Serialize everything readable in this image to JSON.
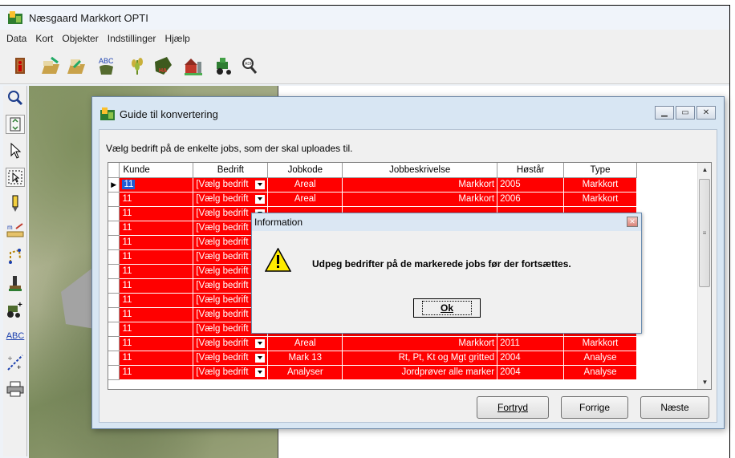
{
  "app": {
    "title": "Næsgaard Markkort OPTI"
  },
  "menu": [
    "Data",
    "Kort",
    "Objekter",
    "Indstillinger",
    "Hjælp"
  ],
  "toolbar": {
    "icons": [
      "exit-icon",
      "import-icon",
      "export-icon",
      "abc-label-icon",
      "crop-icon",
      "field-ha-icon",
      "farm-icon",
      "tractor-icon",
      "magnify-icon"
    ]
  },
  "sidetools": {
    "abc_label": "ABC",
    "icons": [
      "zoom-icon",
      "refresh-icon",
      "pointer-icon",
      "select-icon",
      "pen-icon",
      "measure-icon",
      "polygon-icon",
      "sample-icon",
      "tractor-add-icon",
      "abc-icon",
      "split-icon",
      "print-icon"
    ]
  },
  "dialog": {
    "title": "Guide til konvertering",
    "instruction": "Vælg bedrift på de enkelte jobs, som der skal uploades til.",
    "columns": [
      "Kunde",
      "Bedrift",
      "Jobkode",
      "Jobbeskrivelse",
      "Høstår",
      "Type"
    ],
    "rows": [
      {
        "kunde": "11",
        "bedrift": "[Vælg bedrift",
        "jobkode": "Areal",
        "beskrivelse": "Markkort",
        "hostaar": "2005",
        "type": "Markkort"
      },
      {
        "kunde": "11",
        "bedrift": "[Vælg bedrift",
        "jobkode": "Areal",
        "beskrivelse": "Markkort",
        "hostaar": "2006",
        "type": "Markkort"
      },
      {
        "kunde": "11",
        "bedrift": "[Vælg bedrift",
        "jobkode": "",
        "beskrivelse": "",
        "hostaar": "",
        "type": ""
      },
      {
        "kunde": "11",
        "bedrift": "[Vælg bedrift",
        "jobkode": "",
        "beskrivelse": "",
        "hostaar": "",
        "type": ""
      },
      {
        "kunde": "11",
        "bedrift": "[Vælg bedrift",
        "jobkode": "",
        "beskrivelse": "",
        "hostaar": "",
        "type": ""
      },
      {
        "kunde": "11",
        "bedrift": "[Vælg bedrift",
        "jobkode": "",
        "beskrivelse": "",
        "hostaar": "",
        "type": ""
      },
      {
        "kunde": "11",
        "bedrift": "[Vælg bedrift",
        "jobkode": "",
        "beskrivelse": "",
        "hostaar": "",
        "type": ""
      },
      {
        "kunde": "11",
        "bedrift": "[Vælg bedrift",
        "jobkode": "",
        "beskrivelse": "",
        "hostaar": "",
        "type": ""
      },
      {
        "kunde": "11",
        "bedrift": "[Vælg bedrift",
        "jobkode": "",
        "beskrivelse": "",
        "hostaar": "",
        "type": ""
      },
      {
        "kunde": "11",
        "bedrift": "[Vælg bedrift",
        "jobkode": "",
        "beskrivelse": "",
        "hostaar": "",
        "type": ""
      },
      {
        "kunde": "11",
        "bedrift": "[Vælg bedrift",
        "jobkode": "",
        "beskrivelse": "",
        "hostaar": "",
        "type": ""
      },
      {
        "kunde": "11",
        "bedrift": "[Vælg bedrift",
        "jobkode": "Areal",
        "beskrivelse": "Markkort",
        "hostaar": "2011",
        "type": "Markkort"
      },
      {
        "kunde": "11",
        "bedrift": "[Vælg bedrift",
        "jobkode": "Mark 13",
        "beskrivelse": "Rt, Pt, Kt og Mgt gritted",
        "hostaar": "2004",
        "type": "Analyse"
      },
      {
        "kunde": "11",
        "bedrift": "[Vælg bedrift",
        "jobkode": "Analyser",
        "beskrivelse": "Jordprøver alle marker",
        "hostaar": "2004",
        "type": "Analyse"
      }
    ],
    "buttons": {
      "fortryd": "Fortryd",
      "forrige": "Forrige",
      "naeste": "Næste"
    }
  },
  "message": {
    "title": "Information",
    "text": "Udpeg bedrifter på de markerede jobs før der fortsættes.",
    "ok_label": "Ok"
  },
  "colors": {
    "row_highlight": "#ff0000",
    "selection": "#1e5ed6"
  }
}
